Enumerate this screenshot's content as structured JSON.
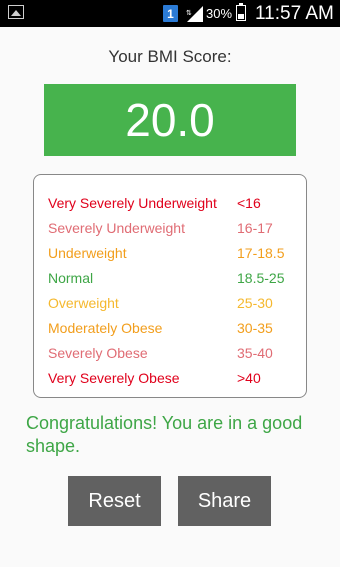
{
  "status_bar": {
    "sim_label": "1",
    "battery": "30%",
    "time": "11:57 AM"
  },
  "title": "Your BMI Score:",
  "score": "20.0",
  "colors": {
    "score_bg": "#47b34d",
    "very_severe": "#e0001b",
    "severe": "#e06c74",
    "mild": "#f29e1c",
    "normal": "#3ea646",
    "button": "#616161"
  },
  "categories": [
    {
      "label": "Very Severely Underweight",
      "range": "<16",
      "color": "#e0001b"
    },
    {
      "label": "Severely Underweight",
      "range": "16-17",
      "color": "#e06c74"
    },
    {
      "label": "Underweight",
      "range": "17-18.5",
      "color": "#f29e1c"
    },
    {
      "label": "Normal",
      "range": "18.5-25",
      "color": "#3ea646"
    },
    {
      "label": "Overweight",
      "range": "25-30",
      "color": "#f5b82e"
    },
    {
      "label": "Moderately Obese",
      "range": "30-35",
      "color": "#f29e1c"
    },
    {
      "label": "Severely Obese",
      "range": "35-40",
      "color": "#e06c74"
    },
    {
      "label": "Very Severely Obese",
      "range": ">40",
      "color": "#e0001b"
    }
  ],
  "message": "Congratulations! You are in a good shape.",
  "buttons": {
    "reset": "Reset",
    "share": "Share"
  }
}
